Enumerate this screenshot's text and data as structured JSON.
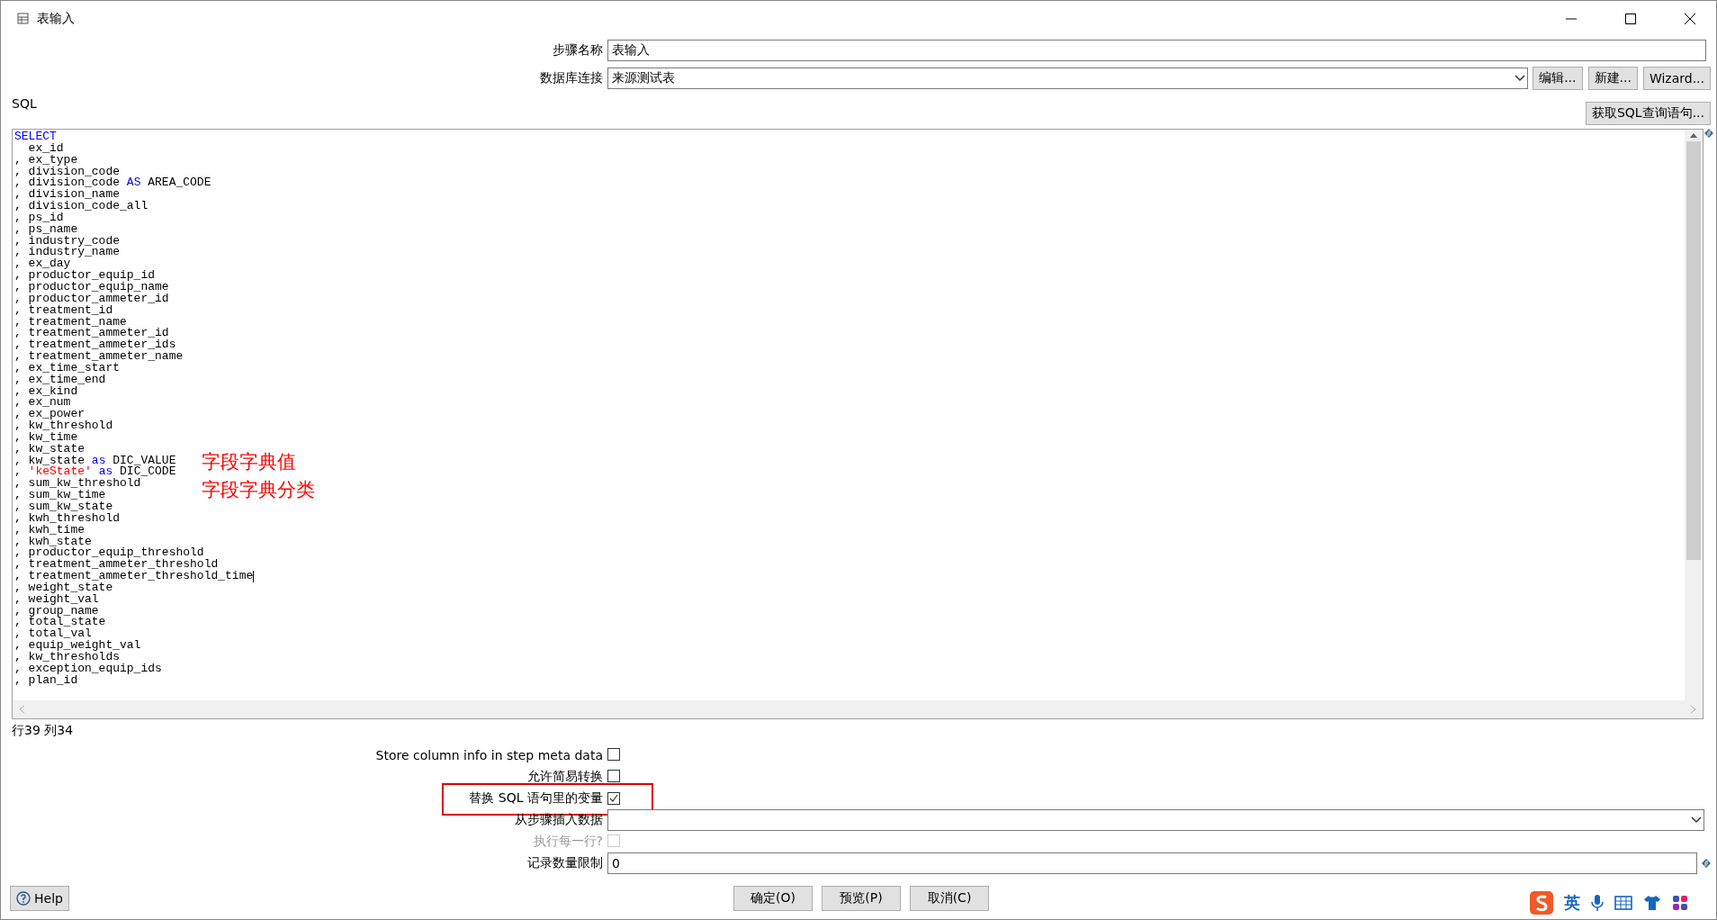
{
  "window": {
    "title": "表输入"
  },
  "step_name": {
    "label": "步骤名称",
    "value": "表输入"
  },
  "connection": {
    "label": "数据库连接",
    "value": "来源测试表",
    "buttons": [
      "编辑...",
      "新建...",
      "Wizard..."
    ]
  },
  "sql": {
    "label": "SQL",
    "get_button": "获取SQL查询语句...",
    "lines": [
      {
        "caret": false,
        "segments": [
          {
            "kind": "keyword",
            "text": "SELECT"
          }
        ]
      },
      {
        "caret": false,
        "segments": [
          {
            "kind": "plain",
            "text": "  ex_id"
          }
        ]
      },
      {
        "caret": false,
        "segments": [
          {
            "kind": "plain",
            "text": ", ex_type"
          }
        ]
      },
      {
        "caret": false,
        "segments": [
          {
            "kind": "plain",
            "text": ", division_code"
          }
        ]
      },
      {
        "caret": false,
        "segments": [
          {
            "kind": "plain",
            "text": ", division_code "
          },
          {
            "kind": "keyword",
            "text": "AS"
          },
          {
            "kind": "plain",
            "text": " AREA_CODE"
          }
        ]
      },
      {
        "caret": false,
        "segments": [
          {
            "kind": "plain",
            "text": ", division_name"
          }
        ]
      },
      {
        "caret": false,
        "segments": [
          {
            "kind": "plain",
            "text": ", division_code_all"
          }
        ]
      },
      {
        "caret": false,
        "segments": [
          {
            "kind": "plain",
            "text": ", ps_id"
          }
        ]
      },
      {
        "caret": false,
        "segments": [
          {
            "kind": "plain",
            "text": ", ps_name"
          }
        ]
      },
      {
        "caret": false,
        "segments": [
          {
            "kind": "plain",
            "text": ", industry_code"
          }
        ]
      },
      {
        "caret": false,
        "segments": [
          {
            "kind": "plain",
            "text": ", industry_name"
          }
        ]
      },
      {
        "caret": false,
        "segments": [
          {
            "kind": "plain",
            "text": ", ex_day"
          }
        ]
      },
      {
        "caret": false,
        "segments": [
          {
            "kind": "plain",
            "text": ", productor_equip_id"
          }
        ]
      },
      {
        "caret": false,
        "segments": [
          {
            "kind": "plain",
            "text": ", productor_equip_name"
          }
        ]
      },
      {
        "caret": false,
        "segments": [
          {
            "kind": "plain",
            "text": ", productor_ammeter_id"
          }
        ]
      },
      {
        "caret": false,
        "segments": [
          {
            "kind": "plain",
            "text": ", treatment_id"
          }
        ]
      },
      {
        "caret": false,
        "segments": [
          {
            "kind": "plain",
            "text": ", treatment_name"
          }
        ]
      },
      {
        "caret": false,
        "segments": [
          {
            "kind": "plain",
            "text": ", treatment_ammeter_id"
          }
        ]
      },
      {
        "caret": false,
        "segments": [
          {
            "kind": "plain",
            "text": ", treatment_ammeter_ids"
          }
        ]
      },
      {
        "caret": false,
        "segments": [
          {
            "kind": "plain",
            "text": ", treatment_ammeter_name"
          }
        ]
      },
      {
        "caret": false,
        "segments": [
          {
            "kind": "plain",
            "text": ", ex_time_start"
          }
        ]
      },
      {
        "caret": false,
        "segments": [
          {
            "kind": "plain",
            "text": ", ex_time_end"
          }
        ]
      },
      {
        "caret": false,
        "segments": [
          {
            "kind": "plain",
            "text": ", ex_kind"
          }
        ]
      },
      {
        "caret": false,
        "segments": [
          {
            "kind": "plain",
            "text": ", ex_num"
          }
        ]
      },
      {
        "caret": false,
        "segments": [
          {
            "kind": "plain",
            "text": ", ex_power"
          }
        ]
      },
      {
        "caret": false,
        "segments": [
          {
            "kind": "plain",
            "text": ", kw_threshold"
          }
        ]
      },
      {
        "caret": false,
        "segments": [
          {
            "kind": "plain",
            "text": ", kw_time"
          }
        ]
      },
      {
        "caret": false,
        "segments": [
          {
            "kind": "plain",
            "text": ", kw_state"
          }
        ]
      },
      {
        "caret": false,
        "segments": [
          {
            "kind": "plain",
            "text": ", kw_state "
          },
          {
            "kind": "keyword",
            "text": "as"
          },
          {
            "kind": "plain",
            "text": " DIC_VALUE"
          }
        ]
      },
      {
        "caret": false,
        "segments": [
          {
            "kind": "plain",
            "text": ", "
          },
          {
            "kind": "string",
            "text": "'keState'"
          },
          {
            "kind": "keyword",
            "text": " as"
          },
          {
            "kind": "plain",
            "text": " DIC_CODE"
          }
        ]
      },
      {
        "caret": false,
        "segments": [
          {
            "kind": "plain",
            "text": ", sum_kw_threshold"
          }
        ]
      },
      {
        "caret": false,
        "segments": [
          {
            "kind": "plain",
            "text": ", sum_kw_time"
          }
        ]
      },
      {
        "caret": false,
        "segments": [
          {
            "kind": "plain",
            "text": ", sum_kw_state"
          }
        ]
      },
      {
        "caret": false,
        "segments": [
          {
            "kind": "plain",
            "text": ", kwh_threshold"
          }
        ]
      },
      {
        "caret": false,
        "segments": [
          {
            "kind": "plain",
            "text": ", kwh_time"
          }
        ]
      },
      {
        "caret": false,
        "segments": [
          {
            "kind": "plain",
            "text": ", kwh_state"
          }
        ]
      },
      {
        "caret": false,
        "segments": [
          {
            "kind": "plain",
            "text": ", productor_equip_threshold"
          }
        ]
      },
      {
        "caret": false,
        "segments": [
          {
            "kind": "plain",
            "text": ", treatment_ammeter_threshold"
          }
        ]
      },
      {
        "caret": true,
        "segments": [
          {
            "kind": "plain",
            "text": ", treatment_ammeter_threshold_time"
          }
        ]
      },
      {
        "caret": false,
        "segments": [
          {
            "kind": "plain",
            "text": ", weight_state"
          }
        ]
      },
      {
        "caret": false,
        "segments": [
          {
            "kind": "plain",
            "text": ", weight_val"
          }
        ]
      },
      {
        "caret": false,
        "segments": [
          {
            "kind": "plain",
            "text": ", group_name"
          }
        ]
      },
      {
        "caret": false,
        "segments": [
          {
            "kind": "plain",
            "text": ", total_state"
          }
        ]
      },
      {
        "caret": false,
        "segments": [
          {
            "kind": "plain",
            "text": ", total_val"
          }
        ]
      },
      {
        "caret": false,
        "segments": [
          {
            "kind": "plain",
            "text": ", equip_weight_val"
          }
        ]
      },
      {
        "caret": false,
        "segments": [
          {
            "kind": "plain",
            "text": ", kw_thresholds"
          }
        ]
      },
      {
        "caret": false,
        "segments": [
          {
            "kind": "plain",
            "text": ", exception_equip_ids"
          }
        ]
      },
      {
        "caret": false,
        "segments": [
          {
            "kind": "plain",
            "text": ", plan_id"
          }
        ]
      }
    ],
    "annotations": [
      "字段字典值",
      "字段字典分类"
    ]
  },
  "cursor_position": "行39 列34",
  "options": [
    {
      "kind": "checkbox",
      "label": "Store column info in step meta data",
      "checked": false,
      "disabled": false,
      "highlighted": false
    },
    {
      "kind": "checkbox",
      "label": "允许简易转换",
      "checked": false,
      "disabled": false,
      "highlighted": false
    },
    {
      "kind": "checkbox",
      "label": "替换 SQL 语句里的变量",
      "checked": true,
      "disabled": false,
      "highlighted": true
    },
    {
      "kind": "dropdown",
      "label": "从步骤插入数据",
      "disabled": false,
      "highlighted": false
    },
    {
      "kind": "checkbox",
      "label": "执行每一行?",
      "checked": false,
      "disabled": true,
      "highlighted": false
    },
    {
      "kind": "textfield",
      "label": "记录数量限制",
      "value": "0",
      "disabled": false,
      "highlighted": false
    }
  ],
  "footer": {
    "help": "Help",
    "buttons": [
      "确定(O)",
      "预览(P)",
      "取消(C)"
    ]
  },
  "ime_bar": {
    "mode": "英"
  }
}
